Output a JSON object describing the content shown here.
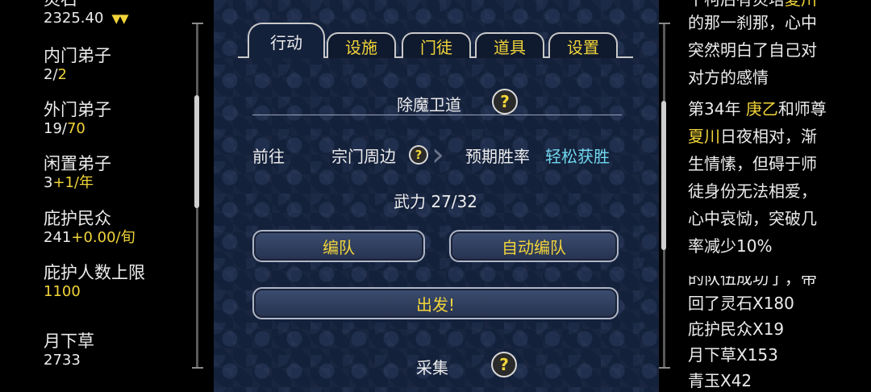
{
  "left": {
    "stats": [
      {
        "name": "灵石",
        "value": "2325.40",
        "extra": ""
      },
      {
        "name": "内门弟子",
        "value": "2/",
        "extra": "2"
      },
      {
        "name": "外门弟子",
        "value": "19/",
        "extra": "70"
      },
      {
        "name": "闲置弟子",
        "value": "3",
        "extra": "+1/年"
      },
      {
        "name": "庇护民众",
        "value": "241",
        "extra": "+0.00/旬"
      },
      {
        "name": "庇护人数上限",
        "value": "",
        "extra": "1100"
      },
      {
        "name": "月下草",
        "value": "2733",
        "extra": ""
      }
    ],
    "trend": "▼▼"
  },
  "tabs": [
    "行动",
    "设施",
    "门徒",
    "道具",
    "设置"
  ],
  "action": {
    "section_title": "除魔卫道",
    "goto_label": "前往",
    "destination": "宗门周边",
    "expect_label": "预期胜率",
    "expect_value": "轻松获胜",
    "power": "武力 27/32",
    "team_button": "编队",
    "auto_team_button": "自动编队",
    "depart_button": "出发!",
    "next_section": "采集"
  },
  "log": {
    "lines": [
      {
        "a": "千柯后有灵培",
        "b": "夏川",
        "c": ""
      },
      {
        "a": "的那一刹那，心中",
        "b": "",
        "c": ""
      },
      {
        "a": "突然明白了自己对",
        "b": "",
        "c": ""
      },
      {
        "a": "对方的感情",
        "b": "",
        "c": ""
      },
      {
        "a": "第34年 ",
        "b": "庚乙",
        "c": "和师尊"
      },
      {
        "a": "",
        "b": "夏川",
        "c": "日夜相对，渐"
      },
      {
        "a": "生情愫，但碍于师",
        "b": "",
        "c": ""
      },
      {
        "a": "徒身份无法相爱，",
        "b": "",
        "c": ""
      },
      {
        "a": "心中哀恸，突破几",
        "b": "",
        "c": ""
      },
      {
        "a": "率减少10%",
        "b": "",
        "c": ""
      },
      {
        "a": "的队伍成功了，带",
        "b": "",
        "c": ""
      },
      {
        "a": "回了灵石X180",
        "b": "",
        "c": ""
      },
      {
        "a": "庇护民众X19",
        "b": "",
        "c": ""
      },
      {
        "a": "月下草X153",
        "b": "",
        "c": ""
      },
      {
        "a": "青玉X42",
        "b": "",
        "c": ""
      }
    ]
  }
}
